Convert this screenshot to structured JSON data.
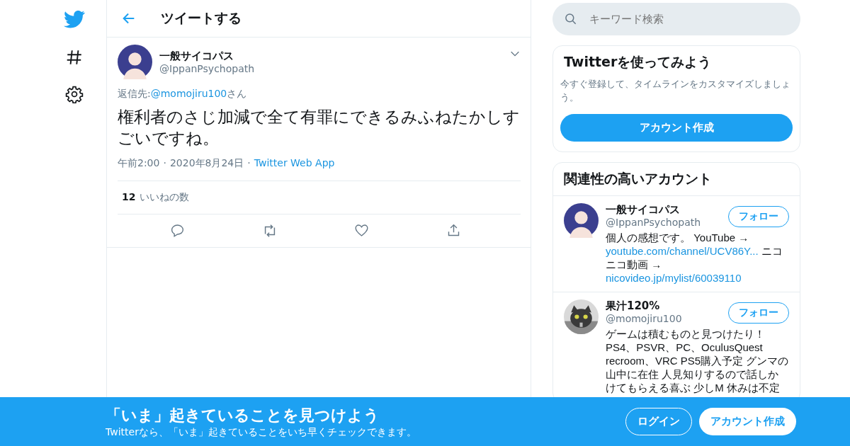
{
  "header": {
    "title": "ツイートする"
  },
  "tweet": {
    "name": "一般サイコパス",
    "handle": "@IppanPsychopath",
    "reply_label": "返信先:",
    "reply_to": "@momojiru100",
    "reply_suffix": "さん",
    "text": "権利者のさじ加減で全て有罪にできるみふねたかしすごいですね。",
    "time": "午前2:00",
    "separator": "·",
    "date": "2020年8月24日",
    "source": "Twitter Web App",
    "likes_count": "12",
    "likes_label": "いいねの数"
  },
  "search": {
    "placeholder": "キーワード検索"
  },
  "signup_card": {
    "title": "Twitterを使ってみよう",
    "text": "今すぐ登録して、タイムラインをカスタマイズしましょう。",
    "button": "アカウント作成"
  },
  "related": {
    "title": "関連性の高いアカウント",
    "accounts": [
      {
        "name": "一般サイコパス",
        "handle": "@IppanPsychopath",
        "follow": "フォロー",
        "bio": [
          {
            "kind": "text",
            "text": "個人の感想です。 YouTube → "
          },
          {
            "kind": "link",
            "text": "youtube.com/channel/UCV86Y..."
          },
          {
            "kind": "text",
            "text": " ニコニコ動画 → "
          },
          {
            "kind": "link",
            "text": "nicovideo.jp/mylist/60039110"
          }
        ]
      },
      {
        "name": "果汁120%",
        "handle": "@momojiru100",
        "follow": "フォロー",
        "bio": [
          {
            "kind": "text",
            "text": "ゲームは積むものと見つけたり！ PS4、PSVR、PC、OculusQuest recroom、VRC PS5購入予定 グンマの山中に在住 人見知りするので話しかけてもらえる喜ぶ 少しM 休みは不定"
          }
        ]
      }
    ]
  },
  "banner": {
    "title": "「いま」起きていることを見つけよう",
    "subtitle": "Twitterなら、「いま」起きていることをいち早くチェックできます。",
    "login": "ログイン",
    "signup": "アカウント作成"
  }
}
